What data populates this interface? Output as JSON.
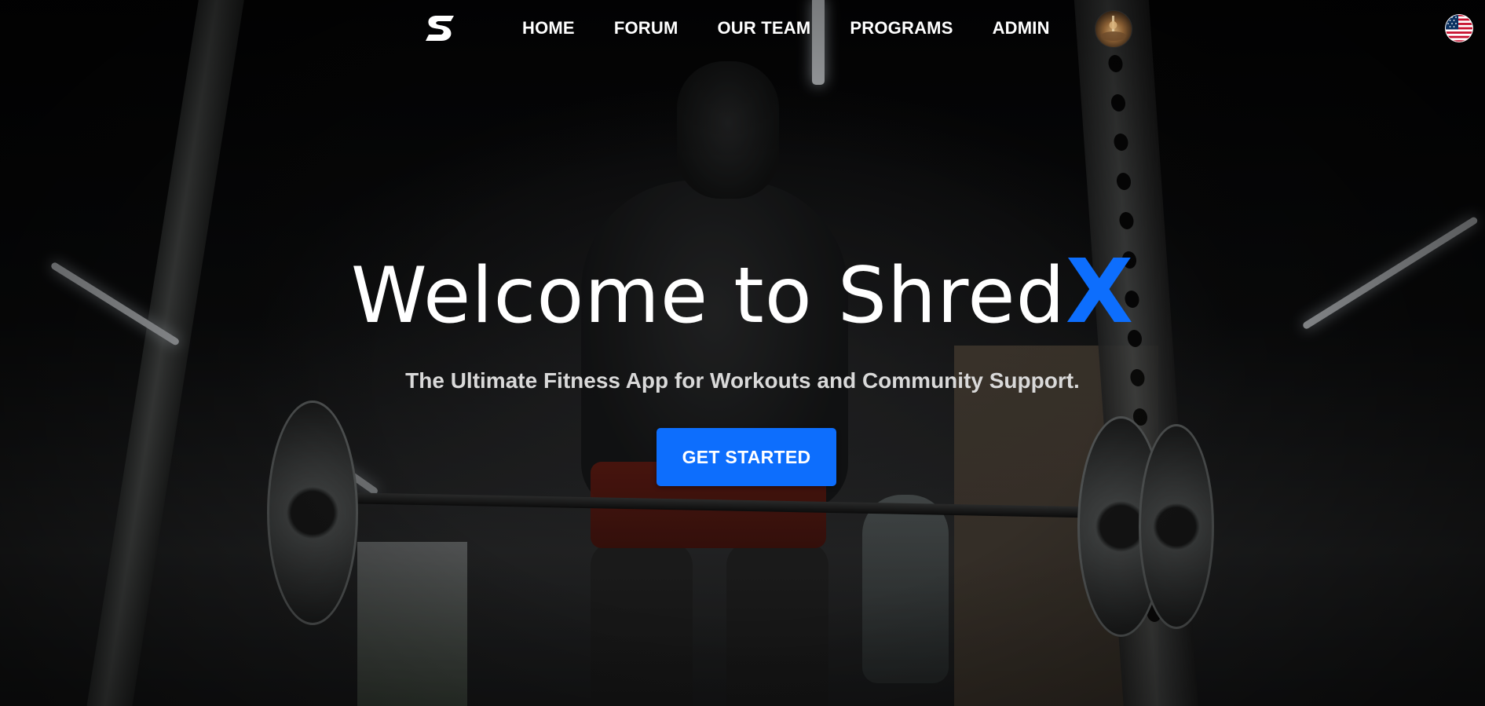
{
  "brand": {
    "logo_icon": "shredx-s-logo-icon",
    "name_main": "Welcome to Shred",
    "name_accent": "X"
  },
  "nav": {
    "links": [
      {
        "label": "HOME"
      },
      {
        "label": "FORUM"
      },
      {
        "label": "OUR TEAM"
      },
      {
        "label": "PROGRAMS"
      },
      {
        "label": "ADMIN"
      }
    ],
    "avatar_icon": "user-avatar",
    "language_icon": "us-flag-icon"
  },
  "hero": {
    "subtitle": "The Ultimate Fitness App for Workouts and Community Support.",
    "cta_label": "GET STARTED"
  },
  "colors": {
    "accent": "#0d6efd",
    "text": "#ffffff",
    "subtitle": "#d9d9d9"
  }
}
